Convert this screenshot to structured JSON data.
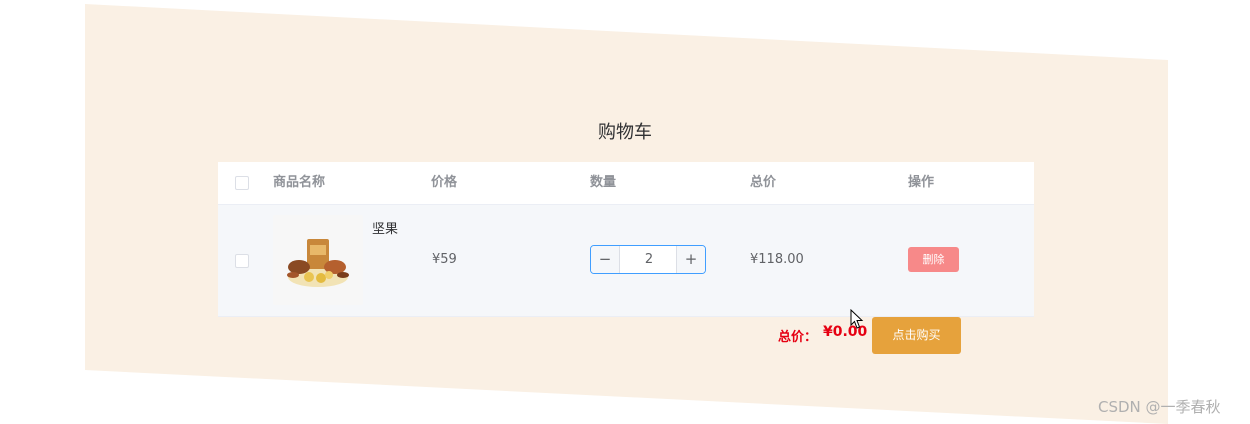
{
  "page": {
    "title": "购物车",
    "background_color": "#faf0e4"
  },
  "table": {
    "columns": [
      "商品名称",
      "价格",
      "数量",
      "总价",
      "操作"
    ],
    "rows": [
      {
        "name": "坚果",
        "image_icon": "nut-snack-image",
        "price": "¥59",
        "quantity": "2",
        "total": "¥118.00",
        "action_label": "删除",
        "checked": false
      }
    ]
  },
  "stepper": {
    "minus_label": "−",
    "plus_label": "+"
  },
  "footer": {
    "total_label": "总价：",
    "total_value": "¥0.00",
    "buy_label": "点击购买"
  },
  "watermark": "CSDN @一季春秋",
  "colors": {
    "accent_blue": "#409eff",
    "danger": "#f78989",
    "warning": "#e6a23c",
    "price_red": "#e60012"
  }
}
